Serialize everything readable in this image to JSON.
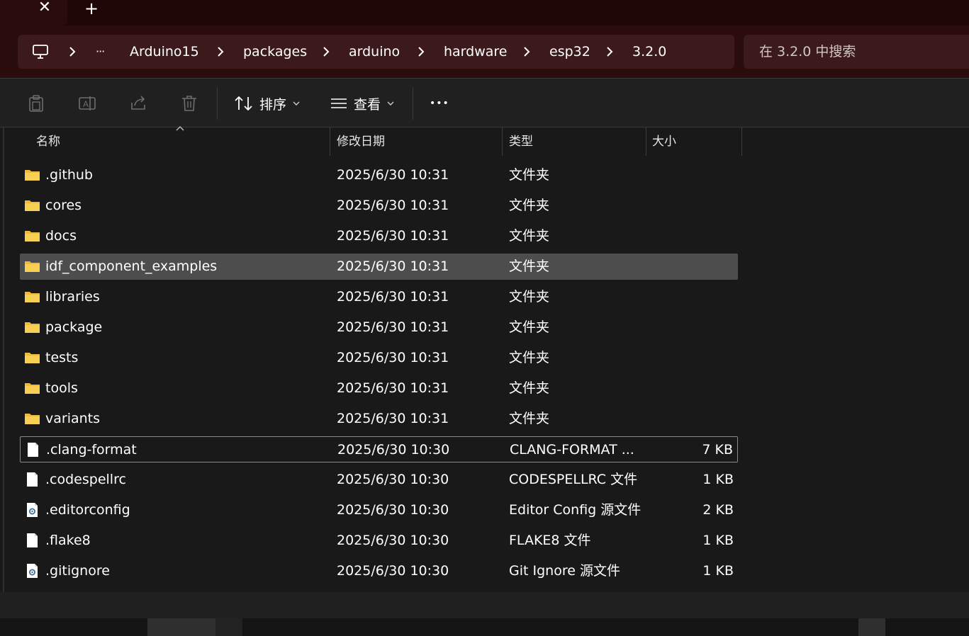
{
  "tabs": {
    "close_glyph": "✕",
    "new_tab_glyph": "+"
  },
  "breadcrumb": {
    "overflow": "···",
    "items": [
      "Arduino15",
      "packages",
      "arduino",
      "hardware",
      "esp32",
      "3.2.0"
    ]
  },
  "search": {
    "placeholder": "在 3.2.0 中搜索"
  },
  "toolbar": {
    "sort_label": "排序",
    "view_label": "查看",
    "more_glyph": "•••"
  },
  "columns": {
    "name": "名称",
    "date": "修改日期",
    "type": "类型",
    "size": "大小"
  },
  "files": [
    {
      "name": ".github",
      "date": "2025/6/30 10:31",
      "type": "文件夹",
      "size": "",
      "icon": "folder-icon"
    },
    {
      "name": "cores",
      "date": "2025/6/30 10:31",
      "type": "文件夹",
      "size": "",
      "icon": "folder-icon"
    },
    {
      "name": "docs",
      "date": "2025/6/30 10:31",
      "type": "文件夹",
      "size": "",
      "icon": "folder-icon"
    },
    {
      "name": "idf_component_examples",
      "date": "2025/6/30 10:31",
      "type": "文件夹",
      "size": "",
      "icon": "folder-icon",
      "selected": true
    },
    {
      "name": "libraries",
      "date": "2025/6/30 10:31",
      "type": "文件夹",
      "size": "",
      "icon": "folder-icon"
    },
    {
      "name": "package",
      "date": "2025/6/30 10:31",
      "type": "文件夹",
      "size": "",
      "icon": "folder-icon"
    },
    {
      "name": "tests",
      "date": "2025/6/30 10:31",
      "type": "文件夹",
      "size": "",
      "icon": "folder-icon"
    },
    {
      "name": "tools",
      "date": "2025/6/30 10:31",
      "type": "文件夹",
      "size": "",
      "icon": "folder-icon"
    },
    {
      "name": "variants",
      "date": "2025/6/30 10:31",
      "type": "文件夹",
      "size": "",
      "icon": "folder-icon"
    },
    {
      "name": ".clang-format",
      "date": "2025/6/30 10:30",
      "type": "CLANG-FORMAT ...",
      "size": "7 KB",
      "icon": "file-icon",
      "focused": true
    },
    {
      "name": ".codespellrc",
      "date": "2025/6/30 10:30",
      "type": "CODESPELLRC 文件",
      "size": "1 KB",
      "icon": "file-icon"
    },
    {
      "name": ".editorconfig",
      "date": "2025/6/30 10:30",
      "type": "Editor Config 源文件",
      "size": "2 KB",
      "icon": "config-file-icon"
    },
    {
      "name": ".flake8",
      "date": "2025/6/30 10:30",
      "type": "FLAKE8 文件",
      "size": "1 KB",
      "icon": "file-icon"
    },
    {
      "name": ".gitignore",
      "date": "2025/6/30 10:30",
      "type": "Git Ignore 源文件",
      "size": "1 KB",
      "icon": "config-file-icon"
    }
  ],
  "colors": {
    "title_bar": "#1f0708",
    "address_row": "#2b0c0d",
    "address_box": "#3c1a1b",
    "selected_row": "#4d4d4d",
    "folder_yellow": "#f4c542"
  }
}
